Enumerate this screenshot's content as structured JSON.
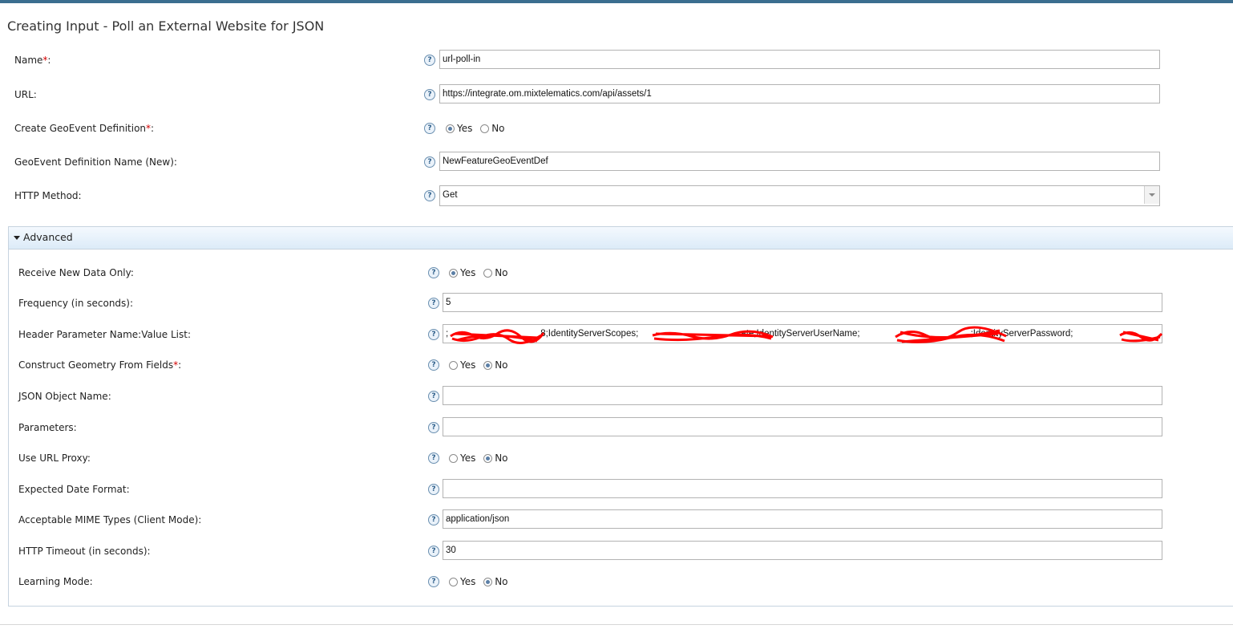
{
  "page_title": "Creating Input - Poll an External Website for JSON",
  "colors": {
    "accent": "#3b6e8f",
    "required": "#d10000",
    "redaction": "#ff0000"
  },
  "main_fields": {
    "name": {
      "label": "Name",
      "required_mark": "*",
      "suffix": ":",
      "value": "url-poll-in"
    },
    "url": {
      "label": "URL:",
      "value": "https://integrate.om.mixtelematics.com/api/assets/1"
    },
    "create_geoevent_def": {
      "label": "Create GeoEvent Definition",
      "required_mark": "*",
      "suffix": ":",
      "yes": "Yes",
      "no": "No",
      "selected": "Yes"
    },
    "geoevent_def_name": {
      "label": "GeoEvent Definition Name (New):",
      "value": "NewFeatureGeoEventDef"
    },
    "http_method": {
      "label": "HTTP Method:",
      "value": "Get"
    }
  },
  "advanced": {
    "title": "Advanced",
    "receive_new_data_only": {
      "label": "Receive New Data Only:",
      "yes": "Yes",
      "no": "No",
      "selected": "Yes"
    },
    "frequency": {
      "label": "Frequency (in seconds):",
      "value": "5"
    },
    "header_params": {
      "label": "Header Parameter Name:Value List:",
      "segments": [
        ";",
        "8;IdentityServerScopes;",
        "ate;IdentityServerUserName;",
        ";IdentityServerPassword;"
      ]
    },
    "construct_geometry": {
      "label": "Construct Geometry From Fields",
      "required_mark": "*",
      "suffix": ":",
      "yes": "Yes",
      "no": "No",
      "selected": "No"
    },
    "json_object_name": {
      "label": "JSON Object Name:",
      "value": ""
    },
    "parameters": {
      "label": "Parameters:",
      "value": ""
    },
    "use_url_proxy": {
      "label": "Use URL Proxy:",
      "yes": "Yes",
      "no": "No",
      "selected": "No"
    },
    "expected_date_format": {
      "label": "Expected Date Format:",
      "value": ""
    },
    "mime_types": {
      "label": "Acceptable MIME Types (Client Mode):",
      "value": "application/json"
    },
    "http_timeout": {
      "label": "HTTP Timeout (in seconds):",
      "value": "30"
    },
    "learning_mode": {
      "label": "Learning Mode:",
      "yes": "Yes",
      "no": "No",
      "selected": "No"
    }
  },
  "icons": {
    "help": "question-mark-help-icon",
    "collapse": "caret-down-icon"
  },
  "help_glyph": "?"
}
